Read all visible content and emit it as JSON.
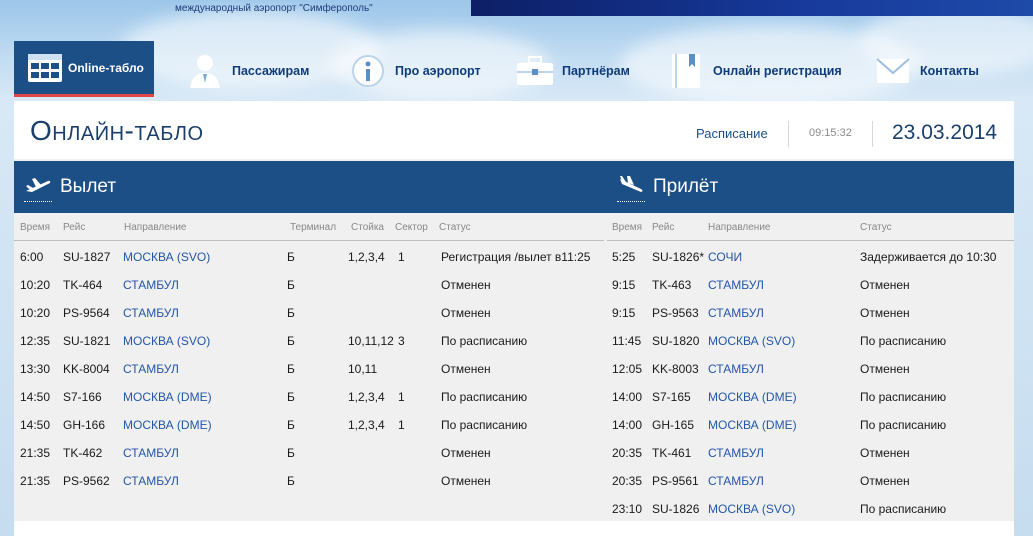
{
  "header": {
    "airport_line": "международный аэропорт \"Симферополь\""
  },
  "nav": {
    "items": [
      {
        "label": "Online-табло",
        "icon": "board-icon",
        "active": true
      },
      {
        "label": "Пассажирам",
        "icon": "passenger-icon",
        "active": false
      },
      {
        "label": "Про аэропорт",
        "icon": "info-icon",
        "active": false
      },
      {
        "label": "Партнёрам",
        "icon": "briefcase-icon",
        "active": false
      },
      {
        "label": "Онлайн регистрация",
        "icon": "book-icon",
        "active": false
      },
      {
        "label": "Контакты",
        "icon": "envelope-icon",
        "active": false
      }
    ]
  },
  "page": {
    "title": "Онлайн-табло",
    "schedule_link": "Расписание",
    "time": "09:15:32",
    "date": "23.03.2014"
  },
  "colors": {
    "navy": "#1c4f86",
    "accent_red": "#e0454a",
    "link": "#2356a8"
  },
  "departures": {
    "title": "Вылет",
    "columns": {
      "time": "Время",
      "flight": "Рейс",
      "destination": "Направление",
      "terminal": "Терминал",
      "counter": "Стойка",
      "sector": "Сектор",
      "status": "Статус"
    },
    "rows": [
      {
        "time": "6:00",
        "flight": "SU-1827",
        "dest": "МОСКВА (SVO)",
        "terminal": "Б",
        "counter": "1,2,3,4",
        "sector": "1",
        "status": "Регистрация /вылет в11:25"
      },
      {
        "time": "10:20",
        "flight": "TK-464",
        "dest": "СТАМБУЛ",
        "terminal": "Б",
        "counter": "",
        "sector": "",
        "status": "Отменен"
      },
      {
        "time": "10:20",
        "flight": "PS-9564",
        "dest": "СТАМБУЛ",
        "terminal": "Б",
        "counter": "",
        "sector": "",
        "status": "Отменен"
      },
      {
        "time": "12:35",
        "flight": "SU-1821",
        "dest": "МОСКВА (SVO)",
        "terminal": "Б",
        "counter": "10,11,12",
        "sector": "3",
        "status": "По расписанию"
      },
      {
        "time": "13:30",
        "flight": "KK-8004",
        "dest": "СТАМБУЛ",
        "terminal": "Б",
        "counter": "10,11",
        "sector": "",
        "status": "Отменен"
      },
      {
        "time": "14:50",
        "flight": "S7-166",
        "dest": "МОСКВА (DME)",
        "terminal": "Б",
        "counter": "1,2,3,4",
        "sector": "1",
        "status": "По расписанию"
      },
      {
        "time": "14:50",
        "flight": "GH-166",
        "dest": "МОСКВА (DME)",
        "terminal": "Б",
        "counter": "1,2,3,4",
        "sector": "1",
        "status": "По расписанию"
      },
      {
        "time": "21:35",
        "flight": "TK-462",
        "dest": "СТАМБУЛ",
        "terminal": "Б",
        "counter": "",
        "sector": "",
        "status": "Отменен"
      },
      {
        "time": "21:35",
        "flight": "PS-9562",
        "dest": "СТАМБУЛ",
        "terminal": "Б",
        "counter": "",
        "sector": "",
        "status": "Отменен"
      }
    ]
  },
  "arrivals": {
    "title": "Прилёт",
    "columns": {
      "time": "Время",
      "flight": "Рейс",
      "destination": "Направление",
      "status": "Статус"
    },
    "rows": [
      {
        "time": "5:25",
        "flight": "SU-1826*",
        "dest": "СОЧИ",
        "status": "Задерживается до 10:30"
      },
      {
        "time": "9:15",
        "flight": "TK-463",
        "dest": "СТАМБУЛ",
        "status": "Отменен"
      },
      {
        "time": "9:15",
        "flight": "PS-9563",
        "dest": "СТАМБУЛ",
        "status": "Отменен"
      },
      {
        "time": "11:45",
        "flight": "SU-1820",
        "dest": "МОСКВА (SVO)",
        "status": "По расписанию"
      },
      {
        "time": "12:05",
        "flight": "KK-8003",
        "dest": "СТАМБУЛ",
        "status": "Отменен"
      },
      {
        "time": "14:00",
        "flight": "S7-165",
        "dest": "МОСКВА (DME)",
        "status": "По расписанию"
      },
      {
        "time": "14:00",
        "flight": "GH-165",
        "dest": "МОСКВА (DME)",
        "status": "По расписанию"
      },
      {
        "time": "20:35",
        "flight": "TK-461",
        "dest": "СТАМБУЛ",
        "status": "Отменен"
      },
      {
        "time": "20:35",
        "flight": "PS-9561",
        "dest": "СТАМБУЛ",
        "status": "Отменен"
      },
      {
        "time": "23:10",
        "flight": "SU-1826",
        "dest": "МОСКВА (SVO)",
        "status": "По расписанию"
      }
    ]
  }
}
